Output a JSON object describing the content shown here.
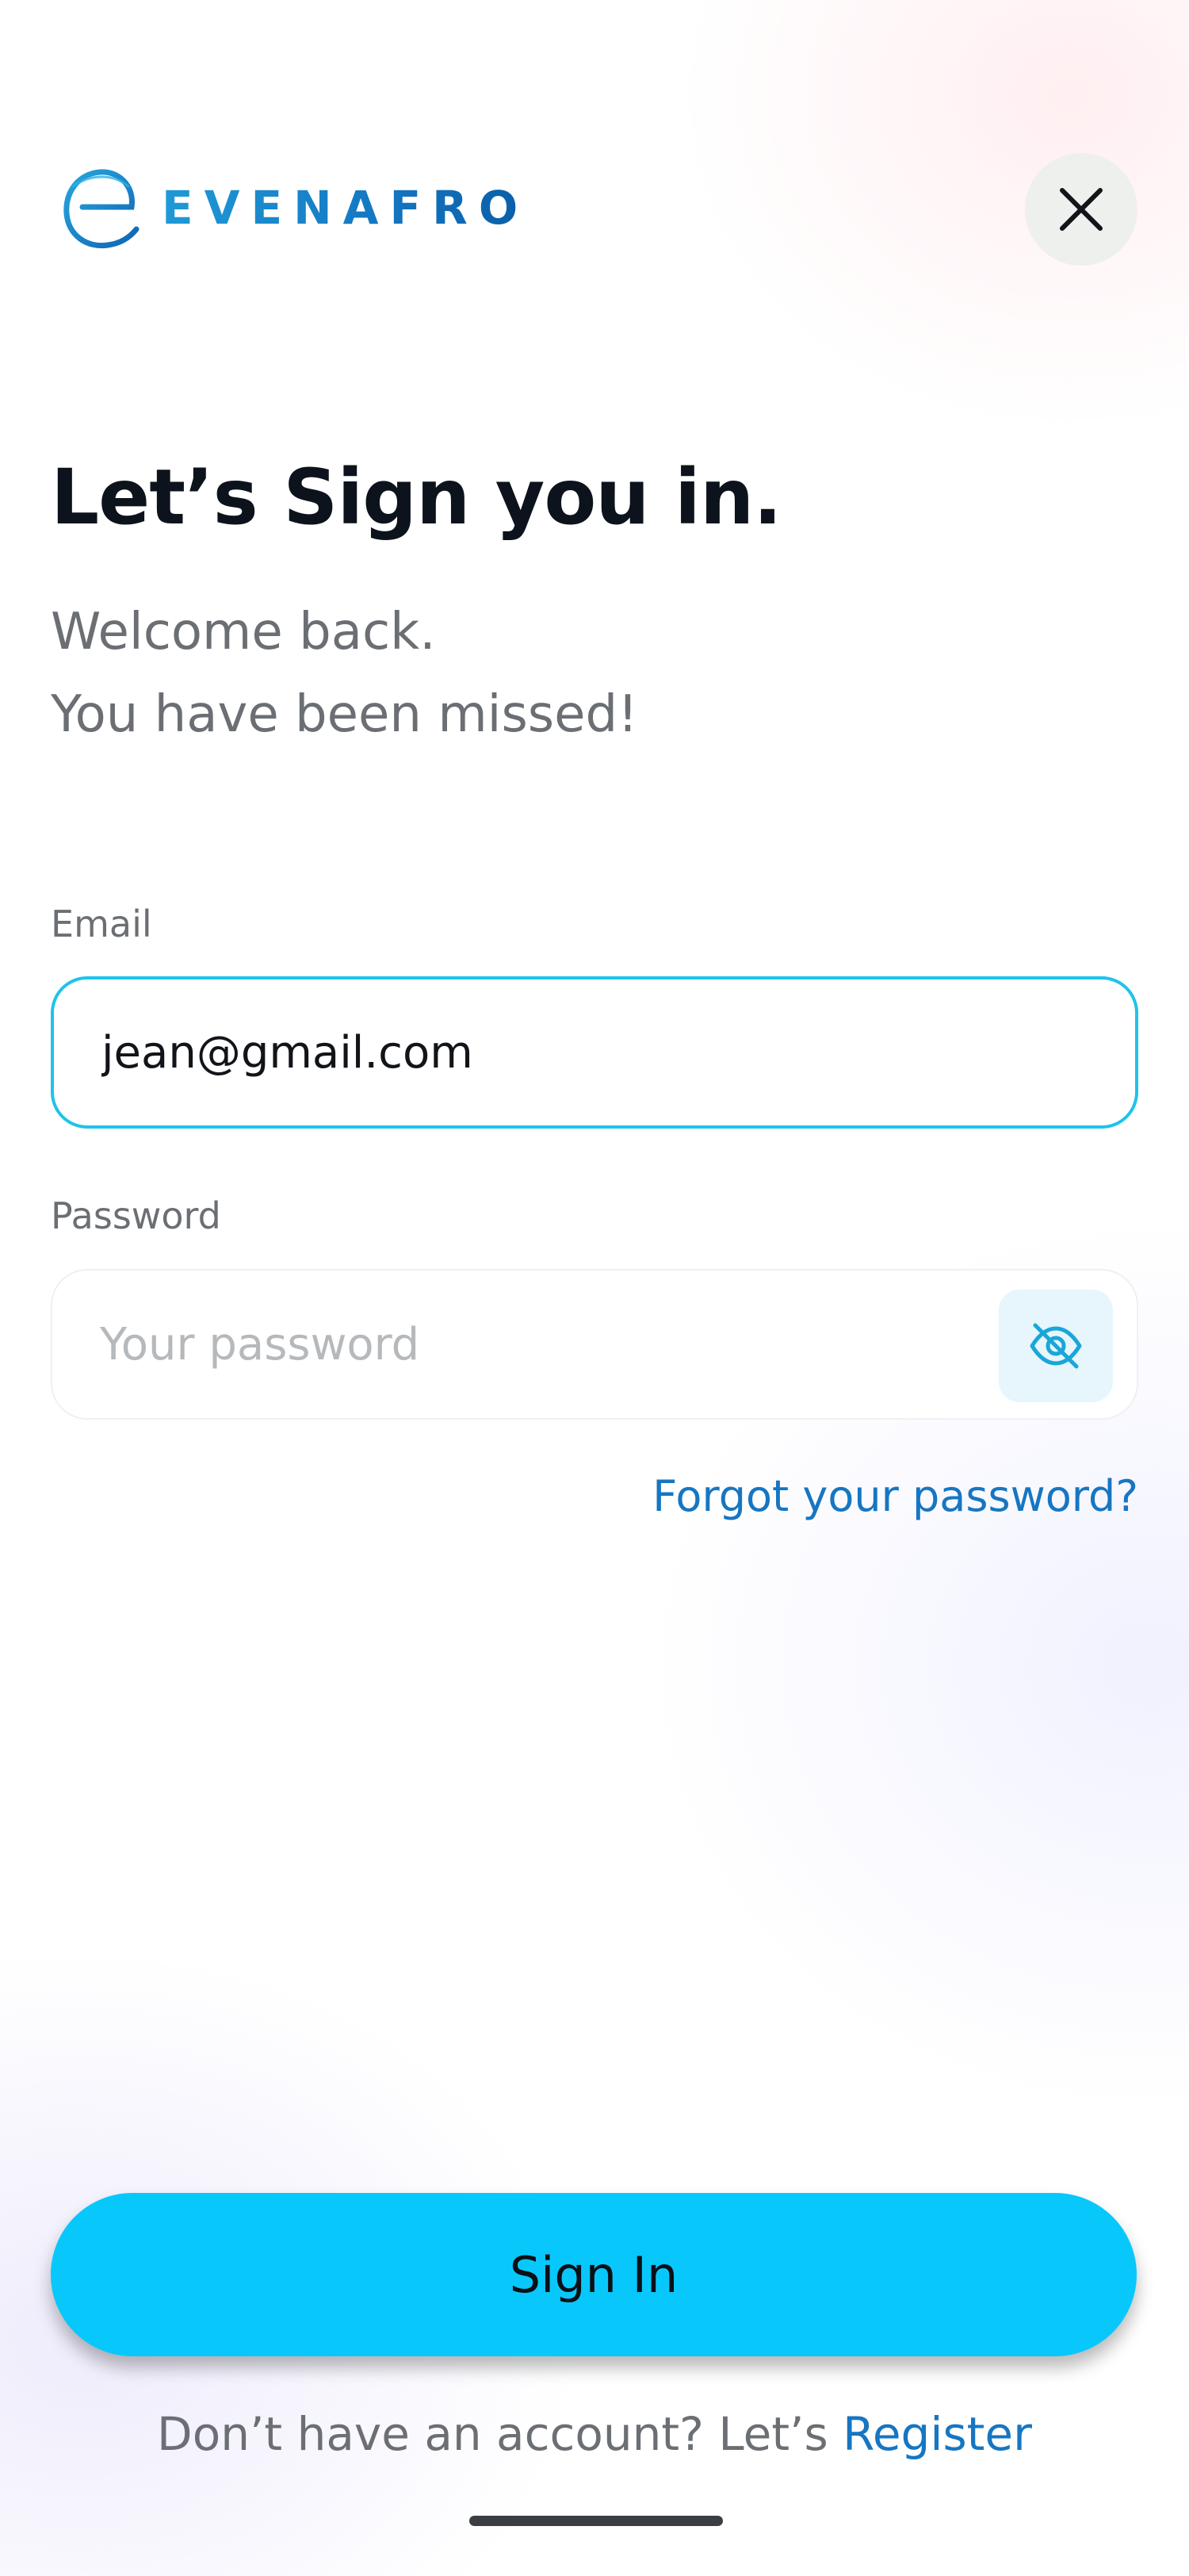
{
  "brand": {
    "name": "EVENAFRO"
  },
  "header": {
    "close_icon": "close-icon"
  },
  "title": "Let’s Sign you in.",
  "subtitle": {
    "line1": "Welcome back.",
    "line2": "You have been missed!"
  },
  "form": {
    "email": {
      "label": "Email",
      "value": "jean@gmail.com"
    },
    "password": {
      "label": "Password",
      "placeholder": "Your password",
      "toggle_icon": "eye-off-icon"
    },
    "forgot_link": "Forgot your password?"
  },
  "actions": {
    "sign_in": "Sign In"
  },
  "footer": {
    "prompt": "Don’t have an account?  Let’s",
    "register_link": "Register"
  },
  "colors": {
    "accent": "#08c8fb",
    "link": "#1676c2",
    "focus_border": "#1fc3ea"
  }
}
